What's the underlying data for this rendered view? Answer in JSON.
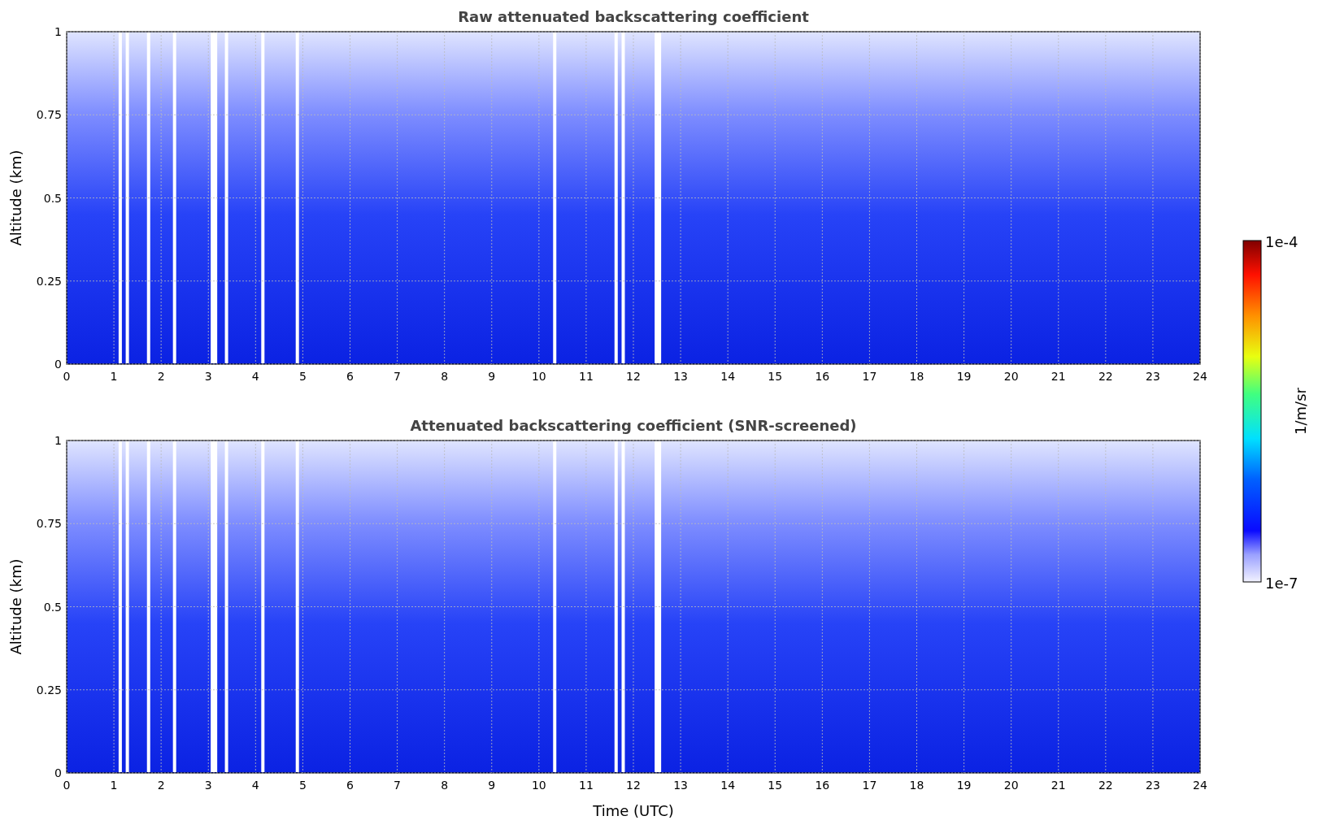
{
  "panels": [
    {
      "title": "Raw attenuated backscattering coefficient",
      "ylabel": "Altitude (km)",
      "yticks": [
        "1",
        "0.75",
        "0.5",
        "0.25",
        "0"
      ],
      "xticks": [
        "0",
        "1",
        "2",
        "3",
        "4",
        "5",
        "6",
        "7",
        "8",
        "9",
        "10",
        "11",
        "12",
        "13",
        "14",
        "15",
        "16",
        "17",
        "18",
        "19",
        "20",
        "21",
        "22",
        "23",
        "24"
      ]
    },
    {
      "title": "Attenuated backscattering coefficient (SNR-screened)",
      "ylabel": "Altitude (km)",
      "yticks": [
        "1",
        "0.75",
        "0.5",
        "0.25",
        "0"
      ],
      "xticks": [
        "0",
        "1",
        "2",
        "3",
        "4",
        "5",
        "6",
        "7",
        "8",
        "9",
        "10",
        "11",
        "12",
        "13",
        "14",
        "15",
        "16",
        "17",
        "18",
        "19",
        "20",
        "21",
        "22",
        "23",
        "24"
      ]
    }
  ],
  "xlabel": "Time (UTC)",
  "colorbar": {
    "max_label": "1e-4",
    "min_label": "1e-7",
    "label": "1/m/sr"
  }
}
